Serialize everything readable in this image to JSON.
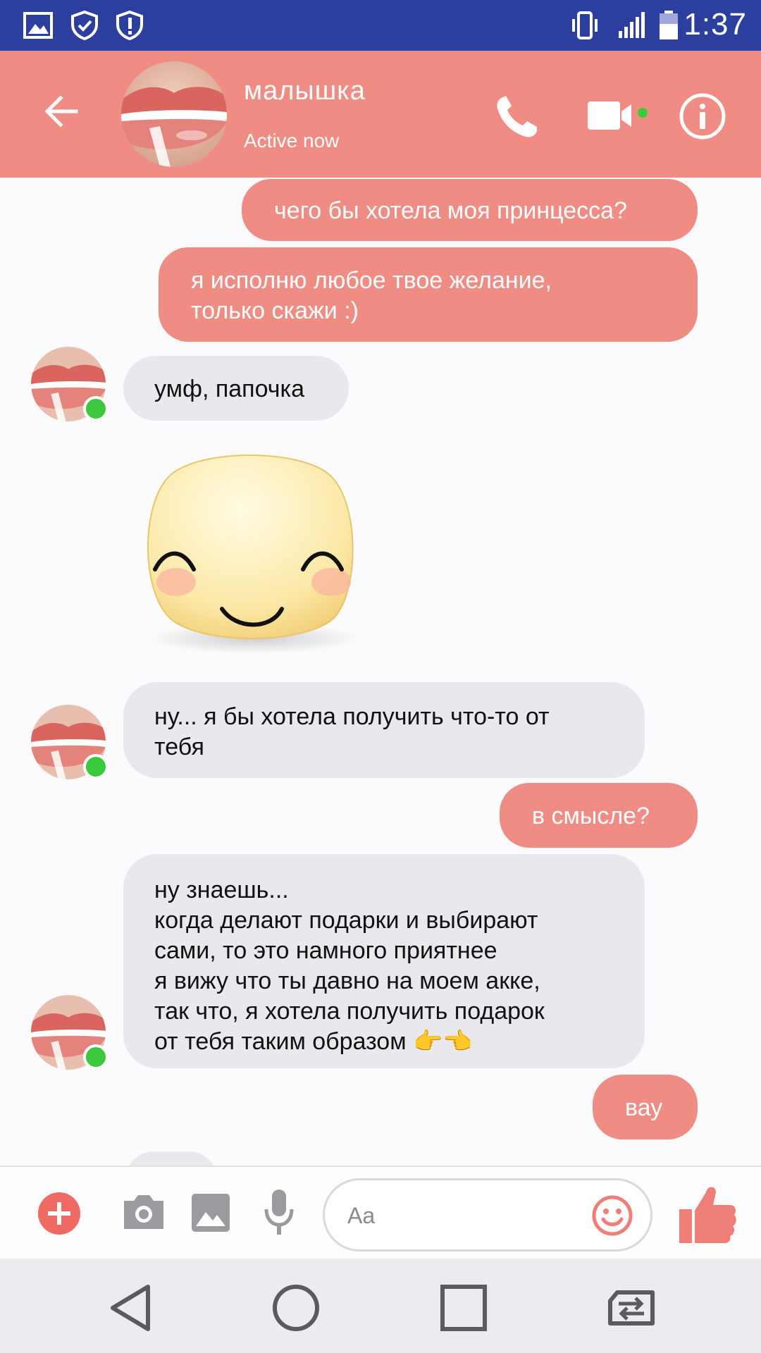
{
  "status_bar": {
    "time": "1:37",
    "icons": [
      "image-icon",
      "shield-check-icon",
      "shield-alert-icon",
      "vibrate-icon",
      "signal-icon",
      "battery-icon"
    ]
  },
  "header": {
    "contact_name": "малышка",
    "status": "Active now",
    "accent_color": "#ef8d84",
    "icons": [
      "back-arrow-icon",
      "phone-icon",
      "video-camera-icon",
      "info-icon"
    ]
  },
  "messages": [
    {
      "direction": "out",
      "text": "чего бы хотела моя принцесса?"
    },
    {
      "direction": "out",
      "text": "я исполню любое твое желание,\nтолько скажи :)"
    },
    {
      "direction": "in",
      "text": "умф, папочка"
    },
    {
      "direction": "in",
      "type": "sticker",
      "sticker": "smiling-blush-face-sticker"
    },
    {
      "direction": "in",
      "text": "ну... я бы хотела получить что-то от\nтебя"
    },
    {
      "direction": "out",
      "text": "в смысле?"
    },
    {
      "direction": "in",
      "text": "ну знаешь...\nкогда делают подарки и выбирают\nсами, то это намного приятнее\nя вижу что ты давно на моем акке,\nтак что, я хотела получить подарок\nот тебя таким образом 👉👈"
    },
    {
      "direction": "out",
      "text": "вау"
    }
  ],
  "composer": {
    "placeholder": "Aa",
    "icons": [
      "plus-icon",
      "camera-icon",
      "gallery-icon",
      "microphone-icon",
      "emoji-icon",
      "thumbs-up-icon"
    ]
  },
  "nav_bar": {
    "icons": [
      "back-triangle-icon",
      "home-circle-icon",
      "recents-square-icon",
      "switch-sim-icon"
    ]
  }
}
